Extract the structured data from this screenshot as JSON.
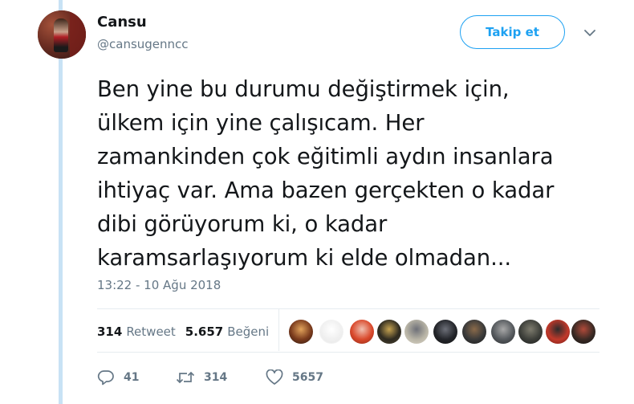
{
  "user": {
    "name": "Cansu",
    "handle": "@cansugenncc"
  },
  "follow_button": "Takip et",
  "tweet": {
    "lines": [
      "Ben yine bu durumu değiştirmek için,",
      "ülkem için yine çalışıcam. Her",
      "zamankinden çok eğitimli aydın insanlara",
      "ihtiyaç var. Ama bazen gerçekten o kadar",
      "dibi görüyorum ki, o kadar",
      "karamsarlaşıyorum ki elde olmadan..."
    ],
    "timestamp": "13:22 - 10 Ağu 2018"
  },
  "stats": {
    "retweet_count": "314",
    "retweet_label": "Retweet",
    "like_count": "5.657",
    "like_label": "Beğeni"
  },
  "actions": {
    "reply_count": "41",
    "retweet_count": "314",
    "like_count": "5657"
  },
  "likers": [
    {
      "colors": [
        "#7a3a1c",
        "#e2a35b",
        "#2b1a12"
      ]
    },
    {
      "colors": [
        "#f0f0f0",
        "#ffffff",
        "#e8e8e8"
      ]
    },
    {
      "colors": [
        "#d9482b",
        "#f0c0b0",
        "#8c2a18"
      ]
    },
    {
      "colors": [
        "#2e2a20",
        "#c6a350",
        "#4d4530"
      ]
    },
    {
      "colors": [
        "#b8b4a6",
        "#6e7078",
        "#dcd6c8"
      ]
    },
    {
      "colors": [
        "#23252a",
        "#6c6f78",
        "#111111"
      ]
    },
    {
      "colors": [
        "#3a3a3a",
        "#8a6a4a",
        "#1a1a1a"
      ]
    },
    {
      "colors": [
        "#565a5e",
        "#a8a8a8",
        "#2a2c2e"
      ]
    },
    {
      "colors": [
        "#3d3f3a",
        "#7e7c6e",
        "#1d1e1c"
      ]
    },
    {
      "colors": [
        "#c0392b",
        "#2c2c2c",
        "#7a1c14"
      ]
    },
    {
      "colors": [
        "#3a2a24",
        "#b04a3a",
        "#111111"
      ]
    }
  ]
}
